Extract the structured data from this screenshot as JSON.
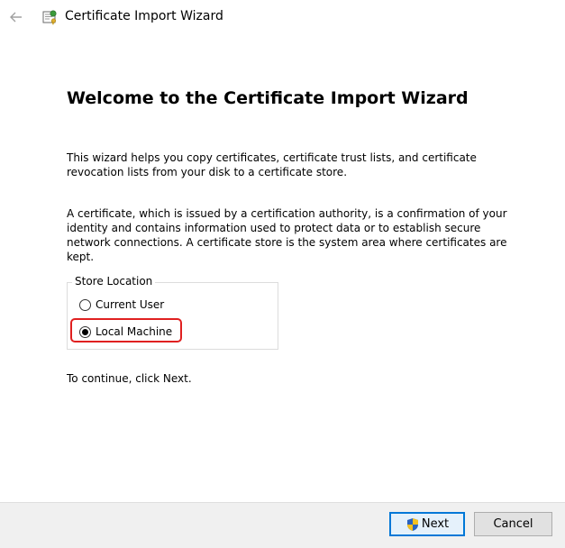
{
  "window": {
    "title": "Certificate Import Wizard"
  },
  "main": {
    "heading": "Welcome to the Certificate Import Wizard",
    "paragraph1": "This wizard helps you copy certificates, certificate trust lists, and certificate revocation lists from your disk to a certificate store.",
    "paragraph2": "A certificate, which is issued by a certification authority, is a confirmation of your identity and contains information used to protect data or to establish secure network connections. A certificate store is the system area where certificates are kept.",
    "store_location": {
      "legend": "Store Location",
      "options": [
        {
          "label": "Current User",
          "checked": false
        },
        {
          "label": "Local Machine",
          "checked": true
        }
      ]
    },
    "continue_text": "To continue, click Next."
  },
  "footer": {
    "next_label": "Next",
    "cancel_label": "Cancel"
  },
  "colors": {
    "highlight": "#e02020",
    "default_button_border": "#0078d7",
    "footer_bg": "#f0f0f0"
  },
  "icons": {
    "back": "back-arrow-icon",
    "wizard": "certificate-wizard-icon",
    "next_shield": "uac-shield-icon"
  }
}
